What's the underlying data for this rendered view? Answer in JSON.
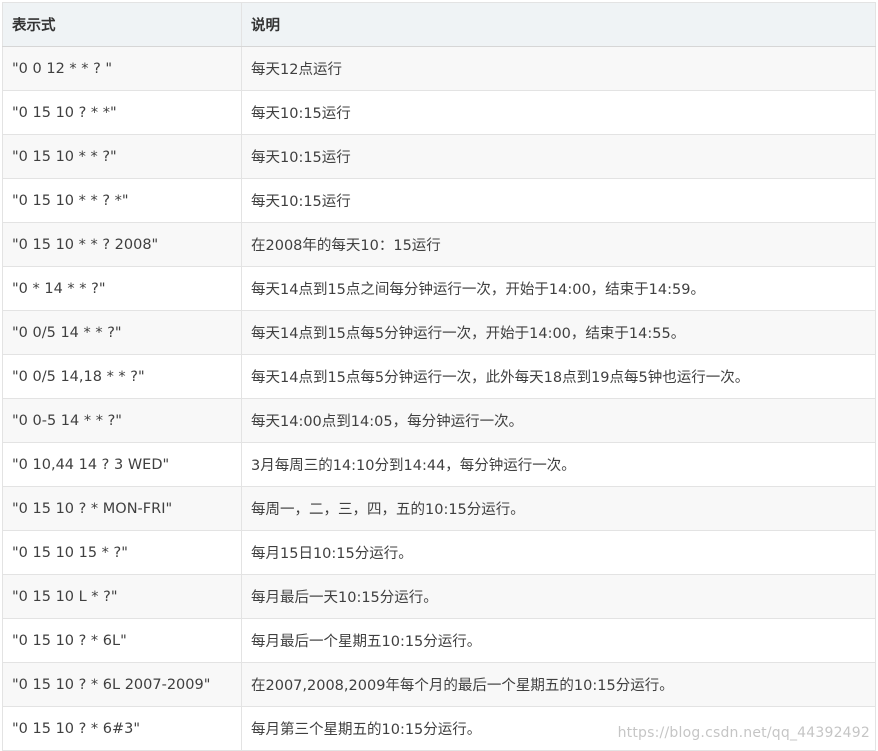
{
  "table": {
    "headers": {
      "expression": "表示式",
      "description": "说明"
    },
    "rows": [
      {
        "expression": "\"0 0 12 * * ? \"",
        "description": "每天12点运行"
      },
      {
        "expression": "\"0 15 10 ? * *\"",
        "description": "每天10:15运行"
      },
      {
        "expression": "\"0 15 10 * * ?\"",
        "description": "每天10:15运行"
      },
      {
        "expression": "\"0 15 10 * * ? *\"",
        "description": "每天10:15运行"
      },
      {
        "expression": "\"0 15 10 * * ? 2008\"",
        "description": "在2008年的每天10：15运行"
      },
      {
        "expression": "\"0 * 14 * * ?\"",
        "description": "每天14点到15点之间每分钟运行一次，开始于14:00，结束于14:59。"
      },
      {
        "expression": "\"0 0/5 14 * * ?\"",
        "description": "每天14点到15点每5分钟运行一次，开始于14:00，结束于14:55。"
      },
      {
        "expression": "\"0 0/5 14,18 * * ?\"",
        "description": "每天14点到15点每5分钟运行一次，此外每天18点到19点每5钟也运行一次。"
      },
      {
        "expression": "\"0 0-5 14 * * ?\"",
        "description": "每天14:00点到14:05，每分钟运行一次。"
      },
      {
        "expression": "\"0 10,44 14 ? 3 WED\"",
        "description": "3月每周三的14:10分到14:44，每分钟运行一次。"
      },
      {
        "expression": "\"0 15 10 ? * MON-FRI\"",
        "description": "每周一，二，三，四，五的10:15分运行。"
      },
      {
        "expression": "\"0 15 10 15 * ?\"",
        "description": "每月15日10:15分运行。"
      },
      {
        "expression": "\"0 15 10 L * ?\"",
        "description": "每月最后一天10:15分运行。"
      },
      {
        "expression": "\"0 15 10 ? * 6L\"",
        "description": "每月最后一个星期五10:15分运行。"
      },
      {
        "expression": "\"0 15 10 ? * 6L 2007-2009\"",
        "description": "在2007,2008,2009年每个月的最后一个星期五的10:15分运行。"
      },
      {
        "expression": "\"0 15 10 ? * 6#3\"",
        "description": "每月第三个星期五的10:15分运行。"
      }
    ]
  },
  "watermark": "https://blog.csdn.net/qq_44392492"
}
